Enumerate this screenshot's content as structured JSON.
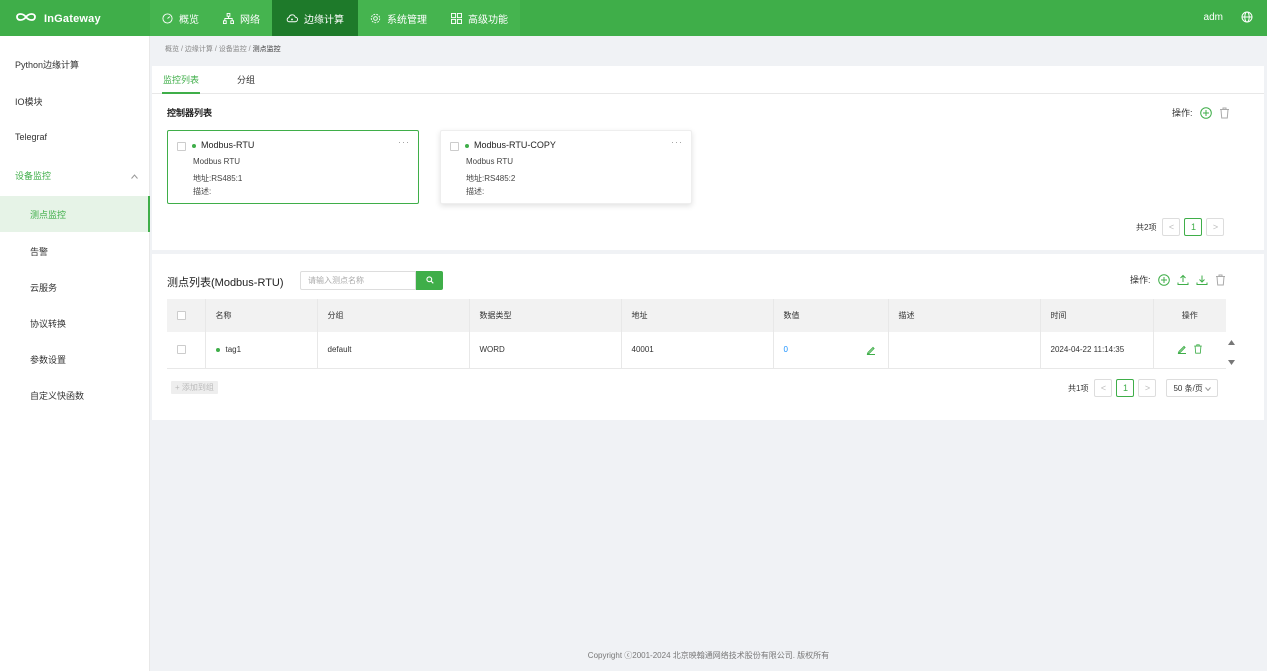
{
  "app": {
    "brand": "InGateway",
    "brand_small": "inhand"
  },
  "nav": [
    {
      "label": "概览",
      "icon": "gauge-icon"
    },
    {
      "label": "网络",
      "icon": "network-icon"
    },
    {
      "label": "边缘计算",
      "icon": "cloud-icon",
      "active": true
    },
    {
      "label": "系统管理",
      "icon": "gear-icon"
    },
    {
      "label": "高级功能",
      "icon": "grid-icon"
    }
  ],
  "user": "adm",
  "sidebar": {
    "items": [
      {
        "label": "Python边缘计算"
      },
      {
        "label": "IO模块"
      },
      {
        "label": "Telegraf"
      },
      {
        "label": "设备监控"
      },
      {
        "label": "测点监控"
      },
      {
        "label": "告警"
      },
      {
        "label": "云服务"
      },
      {
        "label": "协议转换"
      },
      {
        "label": "参数设置"
      },
      {
        "label": "自定义快函数"
      }
    ]
  },
  "breadcrumb": {
    "a": "概览",
    "b": "边缘计算",
    "c": "设备监控",
    "current": "测点监控",
    "sep": "/"
  },
  "tabs": {
    "monitor": "监控列表",
    "group": "分组"
  },
  "controllers": {
    "title": "控制器列表",
    "ops_label": "操作:",
    "cards": [
      {
        "name": "Modbus-RTU",
        "protocol": "Modbus RTU",
        "address": "地址:RS485:1",
        "desc": "描述:",
        "more": "···"
      },
      {
        "name": "Modbus-RTU-COPY",
        "protocol": "Modbus RTU",
        "address": "地址:RS485:2",
        "desc": "描述:",
        "more": "···"
      }
    ],
    "pager": {
      "total": "共2项",
      "page": "1",
      "prev": "<",
      "next": ">"
    }
  },
  "points": {
    "title": "测点列表(Modbus-RTU)",
    "search_placeholder": "请输入测点名称",
    "ops_label": "操作:",
    "columns": [
      "名称",
      "分组",
      "数据类型",
      "地址",
      "数值",
      "描述",
      "时间",
      "操作"
    ],
    "rows": [
      {
        "name": "tag1",
        "group": "default",
        "type": "WORD",
        "address": "40001",
        "value": "0",
        "desc": "",
        "time": "2024-04-22 11:14:35"
      }
    ],
    "add_group": "+ 添加到组",
    "pager": {
      "total": "共1项",
      "page": "1",
      "prev": "<",
      "next": ">",
      "size": "50 条/页"
    }
  },
  "footer": "Copyright ⓒ2001-2024 北京映翰通网络技术股份有限公司. 版权所有",
  "colors": {
    "brand": "#3fae49",
    "brand_dark": "#1e7a2a",
    "link": "#1890ff"
  }
}
